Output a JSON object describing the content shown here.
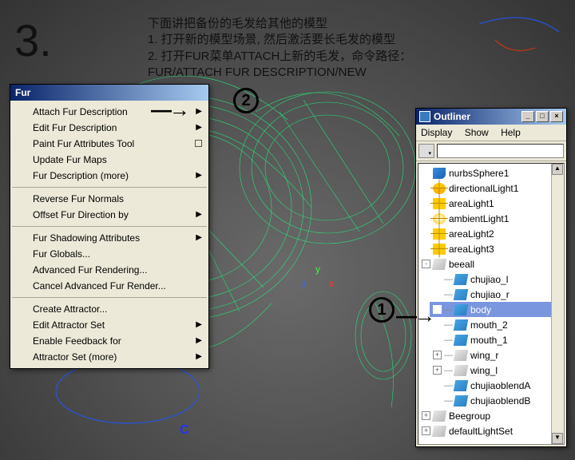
{
  "step": "3.",
  "instructions": {
    "line0": "下面讲把备份的毛发给其他的模型",
    "line1": "1. 打开新的模型场景, 然后激活要长毛发的模型",
    "line2": "2. 打开FUR菜单ATTACH上新的毛发，命令路径：",
    "line3": "FUR/ATTACH FUR DESCRIPTION/NEW"
  },
  "fur_menu": {
    "title": "Fur",
    "groups": [
      [
        {
          "label": "Attach Fur Description",
          "sub": true
        },
        {
          "label": "Edit Fur Description",
          "sub": true
        },
        {
          "label": "Paint Fur Attributes Tool",
          "opt": true
        },
        {
          "label": "Update Fur Maps"
        },
        {
          "label": "Fur Description (more)",
          "sub": true
        }
      ],
      [
        {
          "label": "Reverse Fur Normals"
        },
        {
          "label": "Offset Fur Direction by",
          "sub": true
        }
      ],
      [
        {
          "label": "Fur Shadowing Attributes",
          "sub": true
        },
        {
          "label": "Fur Globals..."
        },
        {
          "label": "Advanced Fur Rendering..."
        },
        {
          "label": "Cancel Advanced Fur Render..."
        }
      ],
      [
        {
          "label": "Create Attractor..."
        },
        {
          "label": "Edit Attractor Set",
          "sub": true
        },
        {
          "label": "Enable Feedback for",
          "sub": true
        },
        {
          "label": "Attractor Set (more)",
          "sub": true
        }
      ]
    ]
  },
  "outliner": {
    "title": "Outliner",
    "menu": [
      "Display",
      "Show",
      "Help"
    ],
    "nodes": [
      {
        "exp": "",
        "icon": "nurbs",
        "indent": 1,
        "label": "nurbsSphere1"
      },
      {
        "exp": "",
        "icon": "dlight",
        "indent": 1,
        "label": "directionalLight1"
      },
      {
        "exp": "",
        "icon": "alight",
        "indent": 1,
        "label": "areaLight1"
      },
      {
        "exp": "",
        "icon": "amb",
        "indent": 1,
        "label": "ambientLight1"
      },
      {
        "exp": "",
        "icon": "alight",
        "indent": 1,
        "label": "areaLight2"
      },
      {
        "exp": "",
        "icon": "alight",
        "indent": 1,
        "label": "areaLight3"
      },
      {
        "exp": "-",
        "icon": "poly",
        "indent": 1,
        "label": "beeall"
      },
      {
        "exp": "",
        "icon": "mesh",
        "indent": 2,
        "label": "chujiao_l",
        "conn": true
      },
      {
        "exp": "",
        "icon": "mesh",
        "indent": 2,
        "label": "chujiao_r",
        "conn": true
      },
      {
        "exp": "",
        "icon": "mesh",
        "indent": 2,
        "label": "body",
        "conn": true,
        "sel": true
      },
      {
        "exp": "",
        "icon": "mesh",
        "indent": 2,
        "label": "mouth_2",
        "conn": true
      },
      {
        "exp": "",
        "icon": "mesh",
        "indent": 2,
        "label": "mouth_1",
        "conn": true
      },
      {
        "exp": "+",
        "icon": "poly",
        "indent": 2,
        "label": "wing_r",
        "conn": true
      },
      {
        "exp": "+",
        "icon": "poly",
        "indent": 2,
        "label": "wing_l",
        "conn": true
      },
      {
        "exp": "",
        "icon": "mesh",
        "indent": 2,
        "label": "chujiaoblendA",
        "conn": true
      },
      {
        "exp": "",
        "icon": "mesh",
        "indent": 2,
        "label": "chujiaoblendB",
        "conn": true
      },
      {
        "exp": "+",
        "icon": "grp",
        "indent": 1,
        "label": "Beegroup"
      },
      {
        "exp": "+",
        "icon": "grp",
        "indent": 1,
        "label": "defaultLightSet"
      }
    ]
  },
  "annotations": {
    "num1": "1",
    "num2": "2",
    "axis_x": "x",
    "axis_y": "y",
    "axis_z": "z",
    "c_label": "C"
  }
}
